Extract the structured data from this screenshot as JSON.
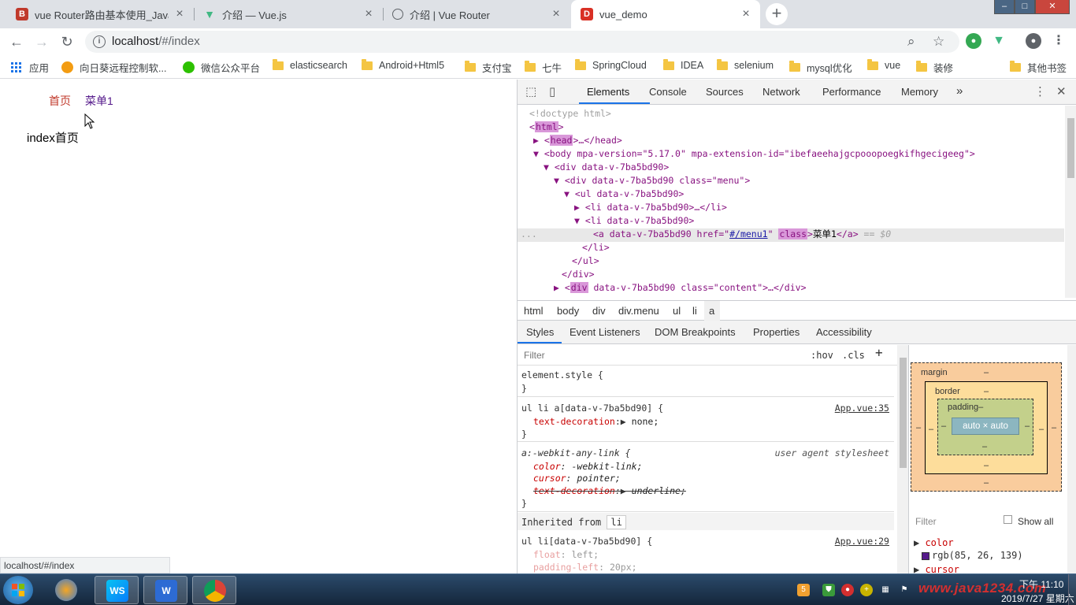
{
  "tabs": [
    {
      "title": "vue Router路由基本使用_Java开",
      "favicon": "B",
      "color": "#c0392b"
    },
    {
      "title": "介绍 — Vue.js",
      "favicon": "V",
      "color": "#41b883"
    },
    {
      "title": "介绍 | Vue Router",
      "favicon": "globe",
      "color": "#5f6368"
    },
    {
      "title": "vue_demo",
      "favicon": "D",
      "color": "#d93025"
    }
  ],
  "address": {
    "host": "localhost",
    "path": "/#/index"
  },
  "bookmarks": [
    "应用",
    "向日葵远程控制软...",
    "微信公众平台",
    "elasticsearch",
    "Android+Html5",
    "支付宝",
    "七牛",
    "SpringCloud",
    "IDEA",
    "selenium",
    "mysql优化",
    "vue",
    "装修",
    "其他书签"
  ],
  "page": {
    "menu": [
      "首页",
      "菜单1"
    ],
    "content": "index首页",
    "status_url": "localhost/#/index"
  },
  "devtools": {
    "tabs": [
      "Elements",
      "Console",
      "Sources",
      "Network",
      "Performance",
      "Memory"
    ],
    "more": "»",
    "tree": {
      "doctype": "<!doctype html>",
      "html": "html",
      "head": "head",
      "head_close": "…</head>",
      "body_attrs": "<body mpa-version=\"5.17.0\" mpa-extension-id=\"ibefaeehajgcpooopoegkifhgecigeeg\">",
      "div1": "<div data-v-7ba5bd90>",
      "div_menu": "<div data-v-7ba5bd90 class=\"menu\">",
      "ul": "<ul data-v-7ba5bd90>",
      "li_collapsed": "<li data-v-7ba5bd90>…</li>",
      "li_open": "<li data-v-7ba5bd90>",
      "a_open": "<a data-v-7ba5bd90 href=\"",
      "a_href": "#/menu1",
      "a_after_href": "\" ",
      "a_class": "class",
      "a_text": "菜单1",
      "a_close": "</a>",
      "a_eq": " == $0",
      "li_close": "</li>",
      "ul_close": "</ul>",
      "div_close": "</div>",
      "div_content_tag": "div",
      "div_content_rest": " data-v-7ba5bd90 class=\"content\">…</div>",
      "ellipsis": "..."
    },
    "breadcrumbs": [
      "html",
      "body",
      "div",
      "div.menu",
      "ul",
      "li",
      "a"
    ],
    "subtabs": [
      "Styles",
      "Event Listeners",
      "DOM Breakpoints",
      "Properties",
      "Accessibility"
    ],
    "filter_placeholder": "Filter",
    "hov": ":hov",
    "cls": ".cls",
    "rules": {
      "element_style": "element.style {",
      "brace_close": "}",
      "rule1_selector": "ul li a[data-v-7ba5bd90] {",
      "rule1_source": "App.vue:35",
      "rule1_prop": "text-decoration",
      "rule1_value": "none;",
      "rule2_selector": "a:-webkit-any-link {",
      "rule2_source": "user agent stylesheet",
      "rule2_p1": "color",
      "rule2_v1": "-webkit-link;",
      "rule2_p2": "cursor",
      "rule2_v2": "pointer;",
      "rule2_p3": "text-decoration",
      "rule2_v3": "underline;",
      "inherited_label": "Inherited from",
      "inherited_tag": "li",
      "rule3_selector": "ul li[data-v-7ba5bd90] {",
      "rule3_source": "App.vue:29",
      "rule3_p1": "float",
      "rule3_v1": "left;",
      "rule3_p2": "padding-left",
      "rule3_v2": "20px;"
    },
    "boxmodel": {
      "margin": "margin",
      "border": "border",
      "padding": "padding–",
      "content": "auto × auto",
      "dash": "–"
    },
    "computed": {
      "filter": "Filter",
      "show_all": "Show all",
      "p1": "color",
      "v1": "rgb(85, 26, 139)",
      "p2": "cursor"
    }
  },
  "taskbar": {
    "watermark": "www.java1234.com",
    "time": "下午 11:10",
    "date": "2019/7/27 星期六"
  }
}
